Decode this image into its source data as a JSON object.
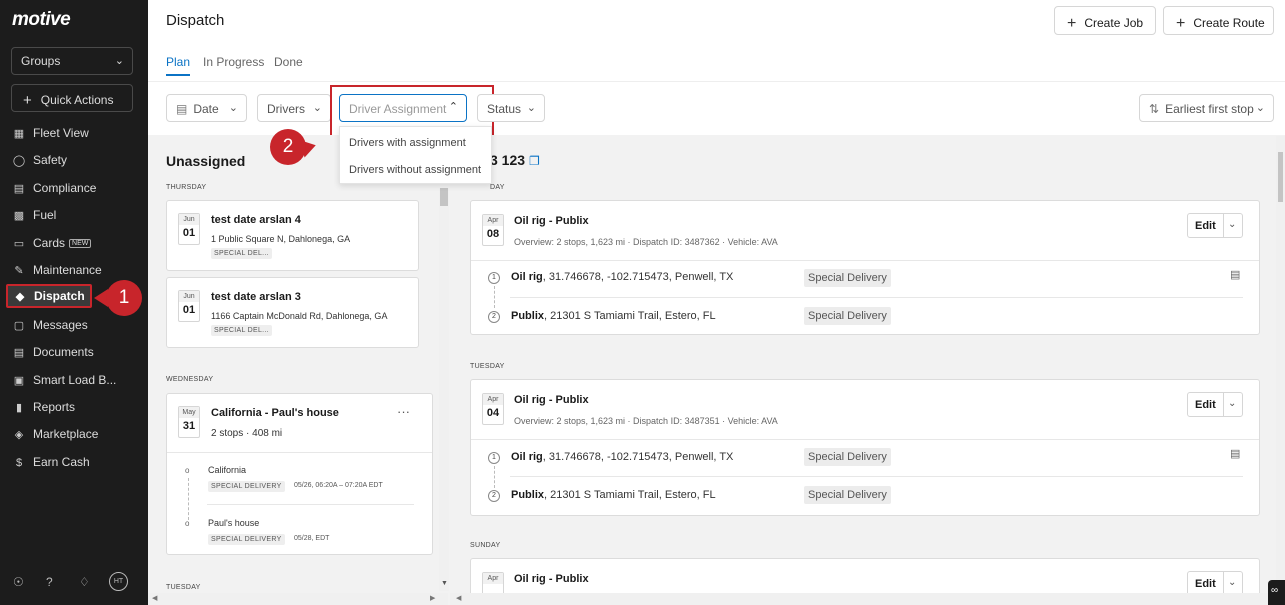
{
  "app": {
    "logo": "motive",
    "groups_label": "Groups",
    "quick_actions_label": "Quick Actions"
  },
  "sidebar": {
    "items": [
      {
        "label": "Fleet View",
        "icon": "map-icon"
      },
      {
        "label": "Safety",
        "icon": "shield-icon"
      },
      {
        "label": "Compliance",
        "icon": "document-icon"
      },
      {
        "label": "Fuel",
        "icon": "fuel-icon"
      },
      {
        "label": "Cards",
        "icon": "card-icon",
        "badge": "NEW"
      },
      {
        "label": "Maintenance",
        "icon": "wrench-icon"
      },
      {
        "label": "Dispatch",
        "icon": "dispatch-pin-icon",
        "active": true
      },
      {
        "label": "Messages",
        "icon": "messages-icon"
      },
      {
        "label": "Documents",
        "icon": "document-icon"
      },
      {
        "label": "Smart Load B...",
        "icon": "truck-icon"
      },
      {
        "label": "Reports",
        "icon": "reports-icon"
      },
      {
        "label": "Marketplace",
        "icon": "marketplace-icon"
      },
      {
        "label": "Earn Cash",
        "icon": "dollar-icon"
      }
    ],
    "avatar_initials": "HT"
  },
  "markers": {
    "one": "1",
    "two": "2"
  },
  "header": {
    "title": "Dispatch",
    "create_job": "Create Job",
    "create_route": "Create Route",
    "tabs": [
      "Plan",
      "In Progress",
      "Done"
    ]
  },
  "filters": {
    "date": "Date",
    "drivers": "Drivers",
    "driver_assignment": "Driver Assignment",
    "status": "Status",
    "sort": "Earliest first stop",
    "dropdown_options": [
      "Drivers with assignment",
      "Drivers without assignment"
    ]
  },
  "unassigned": {
    "title": "Unassigned",
    "groups": [
      {
        "day": "THURSDAY",
        "cards": [
          {
            "month": "Jun",
            "day": "01",
            "title": "test date arslan 4",
            "address": "1 Public Square N, Dahlonega, GA",
            "tag": "SPECIAL DEL..."
          },
          {
            "month": "Jun",
            "day": "01",
            "title": "test date arslan 3",
            "address": "1166 Captain McDonald Rd, Dahlonega, GA",
            "tag": "SPECIAL DEL..."
          }
        ]
      },
      {
        "day": "WEDNESDAY",
        "cards": [
          {
            "month": "May",
            "day": "31",
            "title": "California - Paul's house",
            "summary": "2 stops · 408 mi",
            "stops": [
              {
                "name": "California",
                "tag": "SPECIAL DELIVERY",
                "time": "05/26, 06:20A – 07:20A EDT"
              },
              {
                "name": "Paul's house",
                "tag": "SPECIAL DELIVERY",
                "time": "05/28, EDT"
              }
            ]
          }
        ]
      },
      {
        "day": "TUESDAY",
        "cards": []
      }
    ]
  },
  "route": {
    "title": "3 123",
    "groups": [
      {
        "day": "DAY",
        "job": {
          "month": "Apr",
          "day": "08",
          "title": "Oil rig - Publix",
          "overview": "Overview: 2 stops, 1,623 mi",
          "dispatch_id": "Dispatch ID: 3487362",
          "vehicle": "Vehicle: AVA",
          "edit": "Edit",
          "stops": [
            {
              "num": "1",
              "name": "Oil rig",
              "address": ", 31.746678, -102.715473, Penwell, TX",
              "tag": "Special Delivery"
            },
            {
              "num": "2",
              "name": "Publix",
              "address": ", 21301 S Tamiami Trail, Estero, FL",
              "tag": "Special Delivery"
            }
          ]
        }
      },
      {
        "day": "TUESDAY",
        "job": {
          "month": "Apr",
          "day": "04",
          "title": "Oil rig - Publix",
          "overview": "Overview: 2 stops, 1,623 mi",
          "dispatch_id": "Dispatch ID: 3487351",
          "vehicle": "Vehicle: AVA",
          "edit": "Edit",
          "stops": [
            {
              "num": "1",
              "name": "Oil rig",
              "address": ", 31.746678, -102.715473, Penwell, TX",
              "tag": "Special Delivery"
            },
            {
              "num": "2",
              "name": "Publix",
              "address": ", 21301 S Tamiami Trail, Estero, FL",
              "tag": "Special Delivery"
            }
          ]
        }
      },
      {
        "day": "SUNDAY",
        "job": {
          "month": "Apr",
          "title": "Oil rig - Publix",
          "edit": "Edit"
        }
      }
    ]
  }
}
